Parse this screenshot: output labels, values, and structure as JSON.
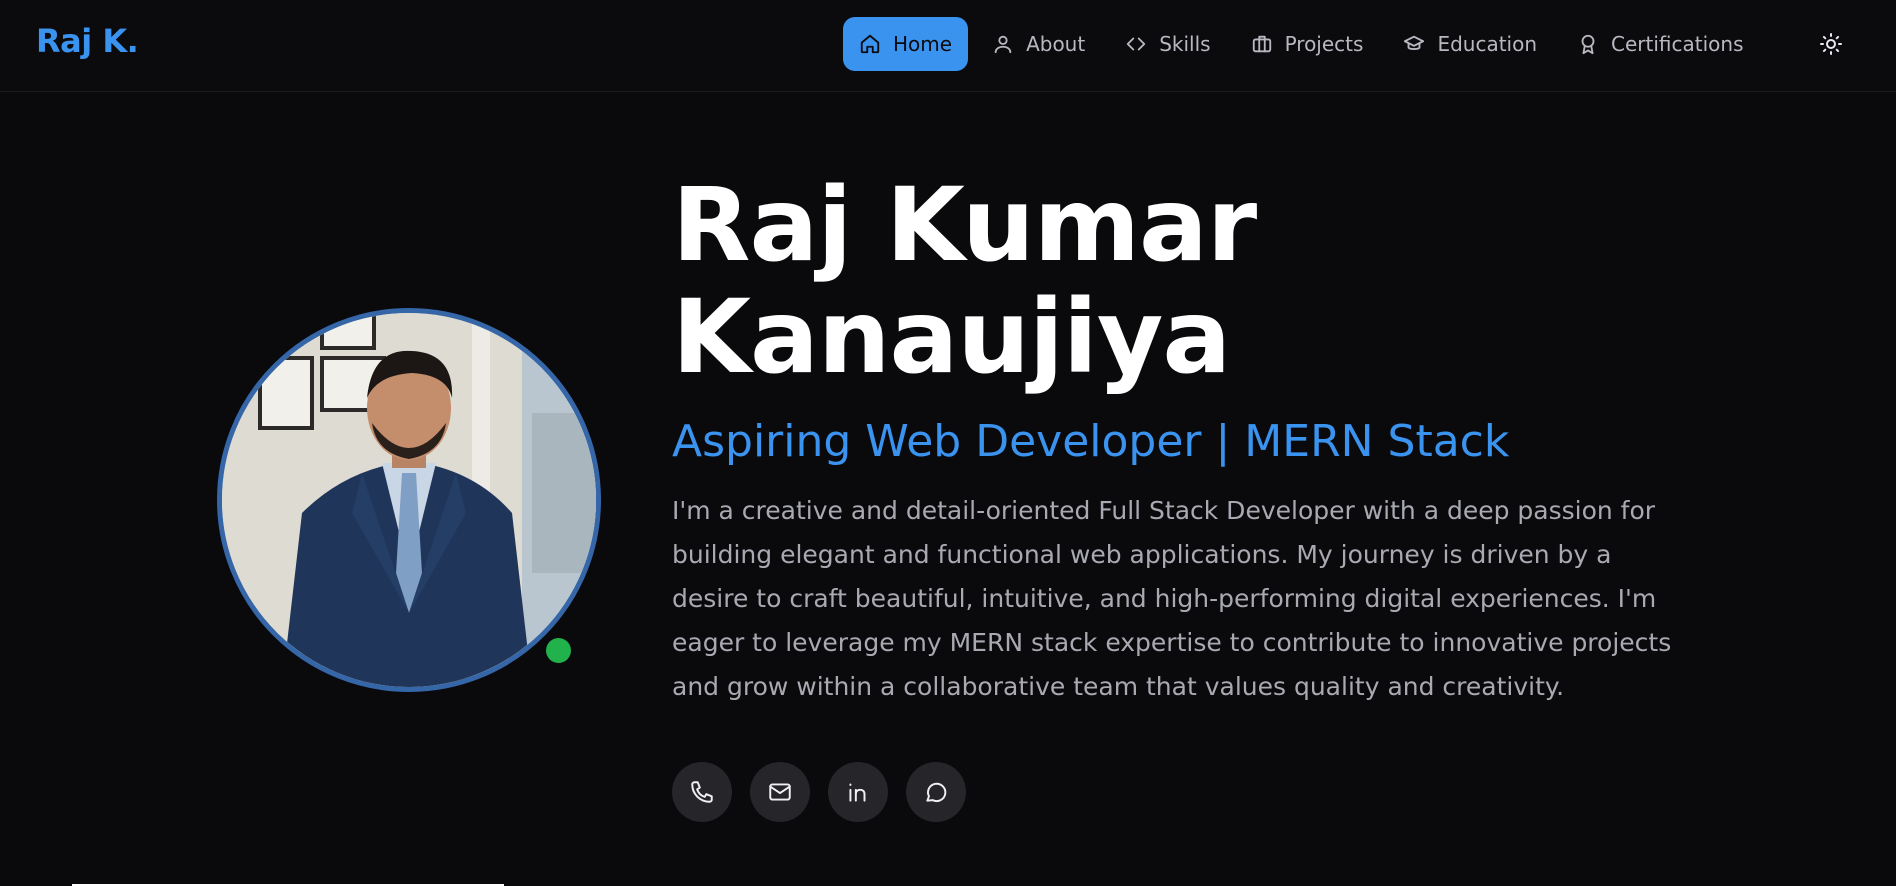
{
  "brand": {
    "logo_text": "Raj K."
  },
  "nav": {
    "items": [
      {
        "label": "Home",
        "icon": "home-icon",
        "active": true
      },
      {
        "label": "About",
        "icon": "user-icon",
        "active": false
      },
      {
        "label": "Skills",
        "icon": "code-icon",
        "active": false
      },
      {
        "label": "Projects",
        "icon": "briefcase-icon",
        "active": false
      },
      {
        "label": "Education",
        "icon": "graduation-cap-icon",
        "active": false
      },
      {
        "label": "Certifications",
        "icon": "award-icon",
        "active": false
      }
    ],
    "theme_toggle_icon": "sun-icon"
  },
  "profile": {
    "photo_icon": "profile-photo",
    "status_color": "#22b24c"
  },
  "hero": {
    "name_line1": "Raj Kumar",
    "name_line2": "Kanaujiya",
    "role": "Aspiring Web Developer | MERN Stack",
    "bio": "I'm a creative and detail-oriented Full Stack Developer with a deep passion for building elegant and functional web applications. My journey is driven by a desire to craft beautiful, intuitive, and high-performing digital experiences. I'm eager to leverage my MERN stack expertise to contribute to innovative projects and grow within a collaborative team that values quality and creativity."
  },
  "socials": [
    {
      "icon": "phone-icon"
    },
    {
      "icon": "mail-icon"
    },
    {
      "icon": "linkedin-icon"
    },
    {
      "icon": "message-icon"
    }
  ],
  "colors": {
    "accent": "#3b93f0",
    "background": "#0a0a0d",
    "text_muted": "#a9a9b2"
  }
}
